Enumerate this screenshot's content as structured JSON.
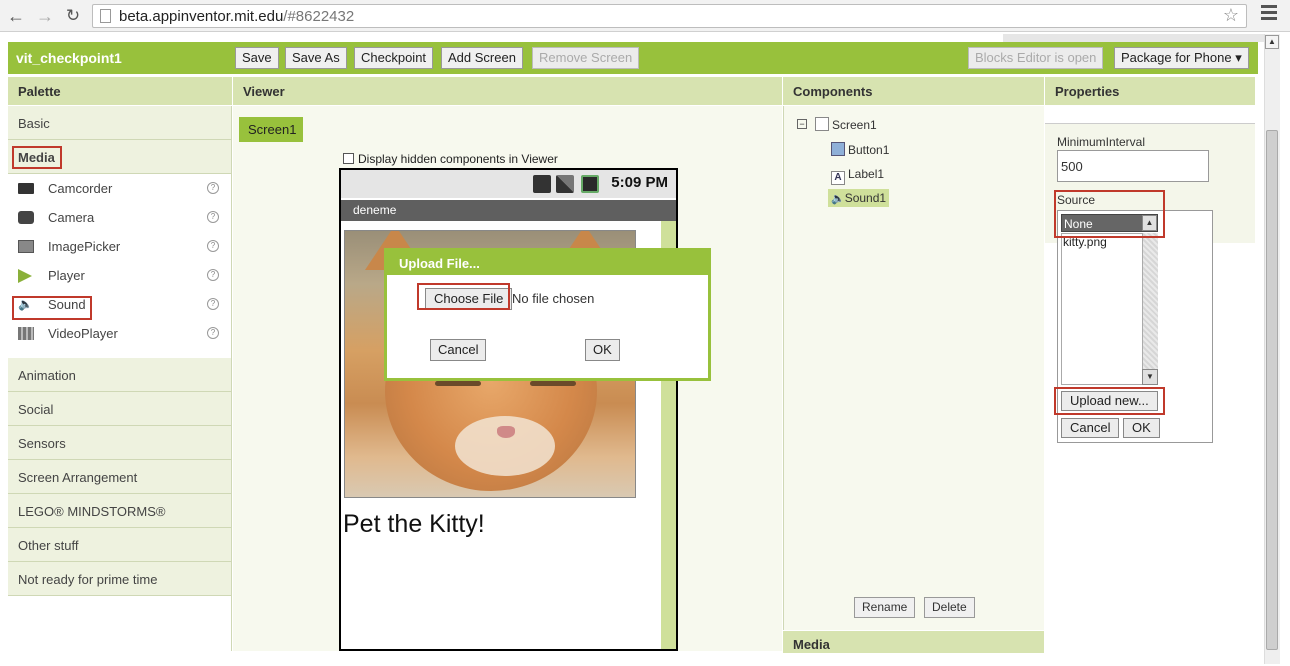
{
  "browser": {
    "url_host": "beta.appinventor.mit.edu",
    "url_path": "/#8622432"
  },
  "toolbar": {
    "project_name": "vit_checkpoint1",
    "save": "Save",
    "save_as": "Save As",
    "checkpoint": "Checkpoint",
    "add_screen": "Add Screen",
    "remove_screen": "Remove Screen",
    "blocks_editor": "Blocks Editor is open",
    "package": "Package for Phone ▾"
  },
  "palette": {
    "header": "Palette",
    "basic": "Basic",
    "media": "Media",
    "items": [
      {
        "label": "Camcorder",
        "icon": "camcorder-icon"
      },
      {
        "label": "Camera",
        "icon": "camera-icon"
      },
      {
        "label": "ImagePicker",
        "icon": "image-picker-icon"
      },
      {
        "label": "Player",
        "icon": "player-icon"
      },
      {
        "label": "Sound",
        "icon": "sound-icon"
      },
      {
        "label": "VideoPlayer",
        "icon": "video-player-icon"
      }
    ],
    "categories": [
      "Animation",
      "Social",
      "Sensors",
      "Screen Arrangement",
      "LEGO® MINDSTORMS®",
      "Other stuff",
      "Not ready for prime time"
    ]
  },
  "viewer": {
    "header": "Viewer",
    "screen_tab": "Screen1",
    "hidden_label": "Display hidden components in Viewer",
    "status_time": "5:09 PM",
    "app_title": "deneme",
    "label_text": "Pet the Kitty!"
  },
  "upload_dialog": {
    "title": "Upload File...",
    "choose": "Choose File",
    "no_file": "No file chosen",
    "cancel": "Cancel",
    "ok": "OK"
  },
  "components": {
    "header": "Components",
    "tree": [
      "Screen1",
      "Button1",
      "Label1",
      "Sound1"
    ],
    "rename": "Rename",
    "delete": "Delete",
    "footer": "Media"
  },
  "properties": {
    "header": "Properties",
    "min_interval_label": "MinimumInterval",
    "min_interval_value": "500",
    "source_label": "Source",
    "source_selected": "None",
    "source_item": "kitty.png",
    "upload_new": "Upload new...",
    "cancel": "Cancel",
    "ok": "OK"
  },
  "colors": {
    "accent_green": "#98c13c",
    "header_green": "#d7e3b0",
    "highlight_red": "#c0392b"
  }
}
